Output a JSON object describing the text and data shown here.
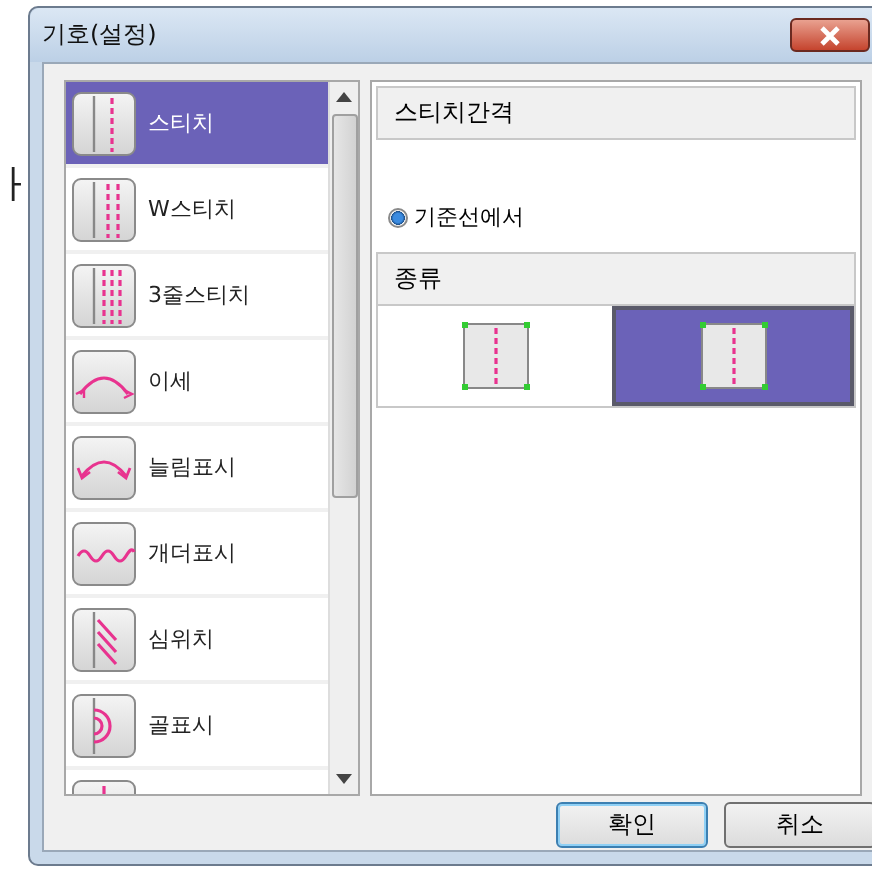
{
  "background_text": "ㅏ",
  "window": {
    "title": "기호(설정)"
  },
  "symbols": [
    {
      "label": "스티치",
      "kind": "stitch1",
      "selected": true
    },
    {
      "label": "W스티치",
      "kind": "stitch2",
      "selected": false
    },
    {
      "label": "3줄스티치",
      "kind": "stitch3",
      "selected": false
    },
    {
      "label": "이세",
      "kind": "ease",
      "selected": false
    },
    {
      "label": "늘림표시",
      "kind": "stretch",
      "selected": false
    },
    {
      "label": "개더표시",
      "kind": "gather",
      "selected": false
    },
    {
      "label": "심위치",
      "kind": "seam",
      "selected": false
    },
    {
      "label": "골표시",
      "kind": "fold",
      "selected": false
    },
    {
      "kind": "partial",
      "selected": false
    }
  ],
  "spacing": {
    "header": "스티치간격",
    "options": [
      {
        "label": "기준선에서",
        "selected": true
      }
    ]
  },
  "type": {
    "header": "종류",
    "options": [
      {
        "kind": "stitch1",
        "selected": false
      },
      {
        "kind": "stitch1",
        "selected": true
      }
    ]
  },
  "buttons": [
    {
      "label": "확인",
      "default": true
    },
    {
      "label": "취소",
      "default": false
    }
  ]
}
